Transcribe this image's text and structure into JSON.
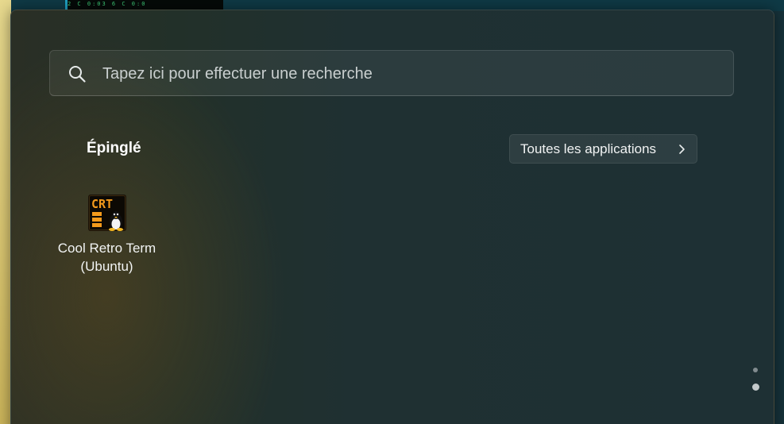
{
  "search": {
    "placeholder": "Tapez ici pour effectuer une recherche",
    "icon": "search-icon"
  },
  "pinned": {
    "title": "Épinglé",
    "all_apps_label": "Toutes les applications",
    "apps": [
      {
        "name_line1": "Cool Retro Term",
        "name_line2": "(Ubuntu)",
        "icon": "cool-retro-term-icon",
        "icon_text": "CRT"
      }
    ]
  },
  "desktop": {
    "terminal_text": "2 C  0:03  6  C  0:0"
  },
  "colors": {
    "panel_background": "#1f3032",
    "accent_amber": "#f39a1c",
    "text_primary": "#ffffff"
  },
  "pagination": {
    "pages": 2,
    "current": 2
  }
}
